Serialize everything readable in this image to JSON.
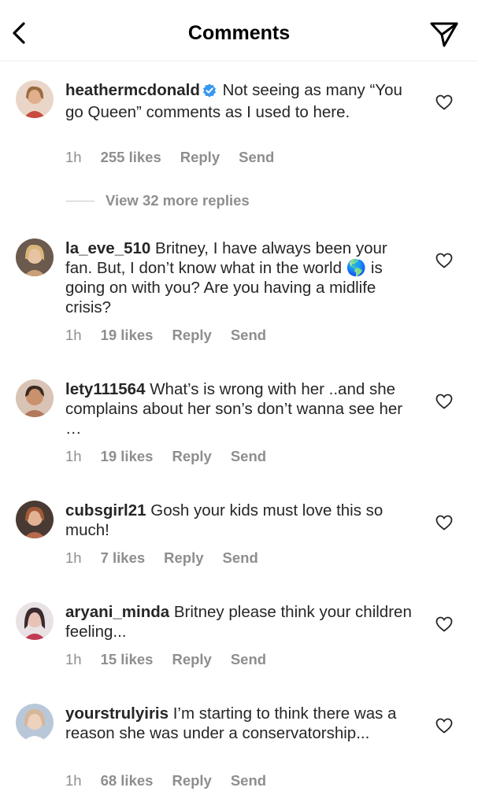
{
  "header": {
    "title": "Comments"
  },
  "comments": [
    {
      "username": "heathermcdonald",
      "verified": true,
      "text": "Not seeing as many “You go Queen” comments as I used to here.",
      "time": "1h",
      "likes": "255 likes",
      "reply": "Reply",
      "send": "Send",
      "avatar_color": "#c94a3f"
    },
    {
      "username": "la_eve_510",
      "verified": false,
      "text": "Britney, I have always been your fan. But, I don’t know what in the world 🌎 is going on with you? Are you having a midlife crisis?",
      "time": "1h",
      "likes": "19 likes",
      "reply": "Reply",
      "send": "Send",
      "avatar_color": "#caa07a"
    },
    {
      "username": "lety111564",
      "verified": false,
      "text": "What’s is wrong with her ..and she complains about her son’s don’t wanna see her …",
      "time": "1h",
      "likes": "19 likes",
      "reply": "Reply",
      "send": "Send",
      "avatar_color": "#b07a5a"
    },
    {
      "username": "cubsgirl21",
      "verified": false,
      "text": "Gosh your kids must love this so much!",
      "time": "1h",
      "likes": "7 likes",
      "reply": "Reply",
      "send": "Send",
      "avatar_color": "#b86a4a"
    },
    {
      "username": "aryani_minda",
      "verified": false,
      "text": "Britney please think your children feeling...",
      "time": "1h",
      "likes": "15 likes",
      "reply": "Reply",
      "send": "Send",
      "avatar_color": "#3b2b2e"
    },
    {
      "username": "yourstrulyiris",
      "verified": false,
      "text": "I’m starting to think there was a reason she was under a conservatorship...",
      "time": "1h",
      "likes": "68 likes",
      "reply": "Reply",
      "send": "Send",
      "avatar_color": "#d6b79a"
    }
  ],
  "view_more_replies": "View 32 more replies",
  "colors": {
    "text": "#262626",
    "meta": "#8e8e8e",
    "verified": "#3897f0"
  }
}
